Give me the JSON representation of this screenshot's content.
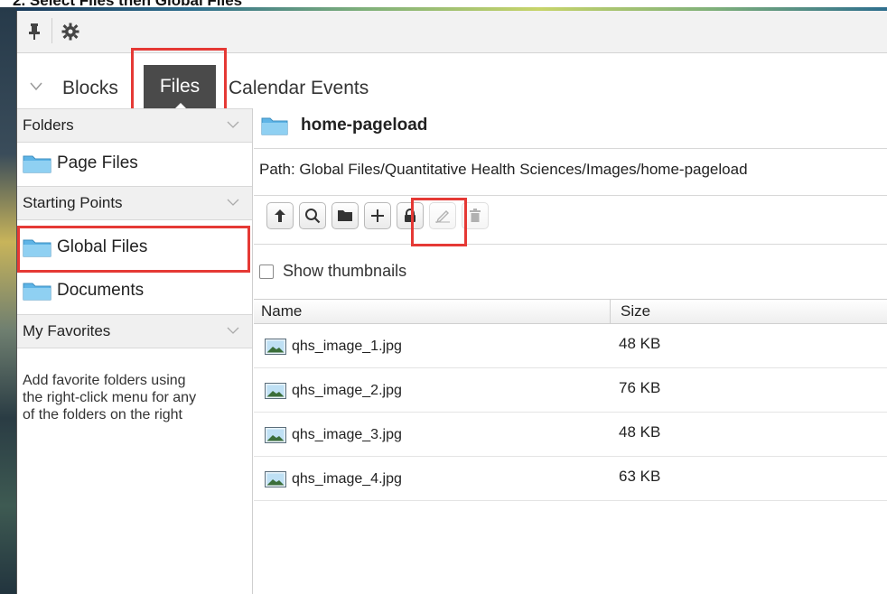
{
  "caption": "2. Select Files then Global Files",
  "toolbar": {
    "pin_icon": "pin-icon",
    "gear_icon": "gear-icon"
  },
  "tabs": {
    "blocks": "Blocks",
    "files": "Files",
    "calendar": "Calendar Events"
  },
  "sidebar": {
    "folders_header": "Folders",
    "page_files": "Page Files",
    "starting_points_header": "Starting Points",
    "global_files": "Global Files",
    "documents": "Documents",
    "favorites_header": "My Favorites",
    "favorites_help": "Add favorite folders using the right-click menu for any of the folders on the right"
  },
  "main": {
    "folder_name": "home-pageload",
    "path": "Path: Global Files/Quantitative Health Sciences/Images/home-pageload",
    "show_thumbnails": "Show thumbnails",
    "columns": {
      "name": "Name",
      "size": "Size"
    },
    "files": [
      {
        "name": "qhs_image_1.jpg",
        "size": "48 KB"
      },
      {
        "name": "qhs_image_2.jpg",
        "size": "76 KB"
      },
      {
        "name": "qhs_image_3.jpg",
        "size": "48 KB"
      },
      {
        "name": "qhs_image_4.jpg",
        "size": "63 KB"
      }
    ]
  },
  "colors": {
    "highlight": "#e53935",
    "active_tab": "#4a4a4a",
    "folder": "#5eb4e6"
  }
}
